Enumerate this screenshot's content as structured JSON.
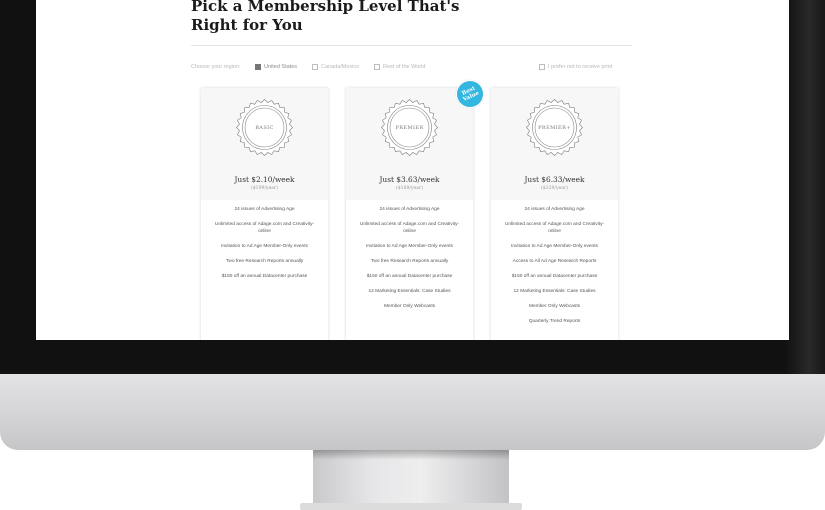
{
  "page": {
    "title": "Pick a Membership Level That's Right for You"
  },
  "region": {
    "label": "Choose your region:",
    "options": [
      {
        "label": "United States",
        "checked": true
      },
      {
        "label": "Canada/Mexico",
        "checked": false
      },
      {
        "label": "Rest of the World",
        "checked": false
      }
    ],
    "print_optout": {
      "label": "I prefer not to receive print",
      "checked": false
    }
  },
  "badge": {
    "line1": "Best",
    "line2": "Value"
  },
  "plans": [
    {
      "seal": "BASIC",
      "price": "Just $2.10/week",
      "yearly": "($109/year)",
      "features": [
        "24 issues of Advertising Age",
        "Unlimited access of Adage.com and Creativity-online",
        "Invitation to Ad Age Member-Only events",
        "Two free Research Reports annually",
        "$150 off an annual Datacenter purchase"
      ]
    },
    {
      "seal": "PREMIER",
      "price": "Just $3.63/week",
      "yearly": "($189/year)",
      "features": [
        "24 issues of Advertising Age",
        "Unlimited access of Adage.com and Creativity-online",
        "Invitation to Ad Age Member-Only events",
        "Two free Research Reports annually",
        "$150 off an annual Datacenter purchase",
        "12 Marketing Essentials: Case Studies",
        "Member Only Webcasts"
      ]
    },
    {
      "seal": "PREMIER+",
      "price": "Just $6.33/week",
      "yearly": "($329/year)",
      "features": [
        "24 issues of Advertising Age",
        "Unlimited access of Adage.com and Creativity-online",
        "Invitation to Ad Age Member-Only events",
        "Access to All Ad Age Research Reports",
        "$150 off an annual Datacenter purchase",
        "12 Marketing Essentials: Case Studies",
        "Member Only Webcasts",
        "Quarterly Trend Reports"
      ]
    }
  ],
  "colors": {
    "badge": "#33b6df",
    "bezel": "#111111",
    "card_top": "#f7f7f7"
  }
}
